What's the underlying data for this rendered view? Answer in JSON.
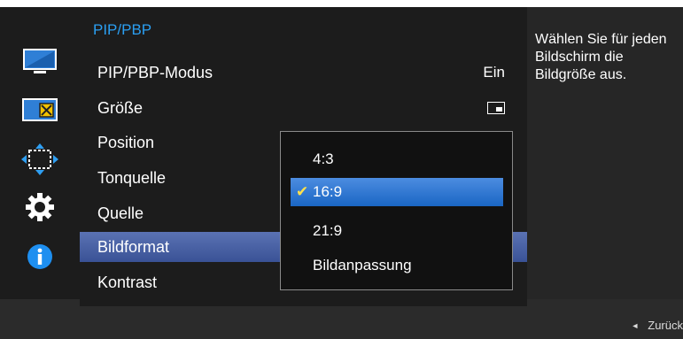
{
  "menu": {
    "title": "PIP/PBP",
    "items": [
      {
        "label": "PIP/PBP-Modus",
        "value": "Ein"
      },
      {
        "label": "Größe",
        "value_icon": "pip-size-icon"
      },
      {
        "label": "Position"
      },
      {
        "label": "Tonquelle"
      },
      {
        "label": "Quelle"
      },
      {
        "label": "Bildformat",
        "selected": true
      },
      {
        "label": "Kontrast"
      }
    ]
  },
  "dropdown": {
    "options": [
      "4:3",
      "16:9",
      "21:9",
      "Bildanpassung"
    ],
    "selected": "16:9",
    "check_icon": "checkmark-icon"
  },
  "description": "Wählen Sie für jeden Bildschirm die Bildgröße aus.",
  "footer": {
    "back_label": "Zurück"
  },
  "sidebar_icons": [
    "picture-icon",
    "pip-icon",
    "resize-icon",
    "settings-gear-icon",
    "info-icon"
  ],
  "colors": {
    "accent_blue": "#2b9ff2",
    "selected_row": "#4a62a6",
    "selected_option": "#2a78d4",
    "check_yellow": "#ffe14d",
    "info_blue": "#1e8ff0"
  }
}
